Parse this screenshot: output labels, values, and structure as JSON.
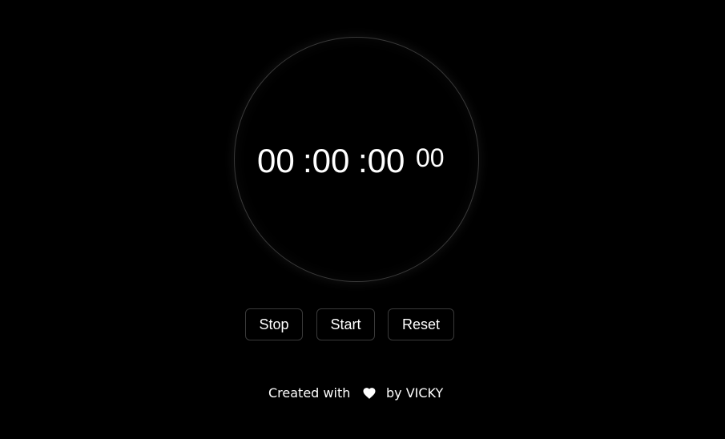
{
  "stopwatch": {
    "hours": "00",
    "minutes": ":00",
    "seconds": ":00",
    "milliseconds": "00"
  },
  "controls": {
    "stop_label": "Stop",
    "start_label": "Start",
    "reset_label": "Reset"
  },
  "footer": {
    "prefix": "Created with",
    "icon": "heart-icon",
    "suffix": "by VICKY"
  },
  "colors": {
    "background": "#000000",
    "text": "#ffffff",
    "border": "#3a3a3a"
  }
}
